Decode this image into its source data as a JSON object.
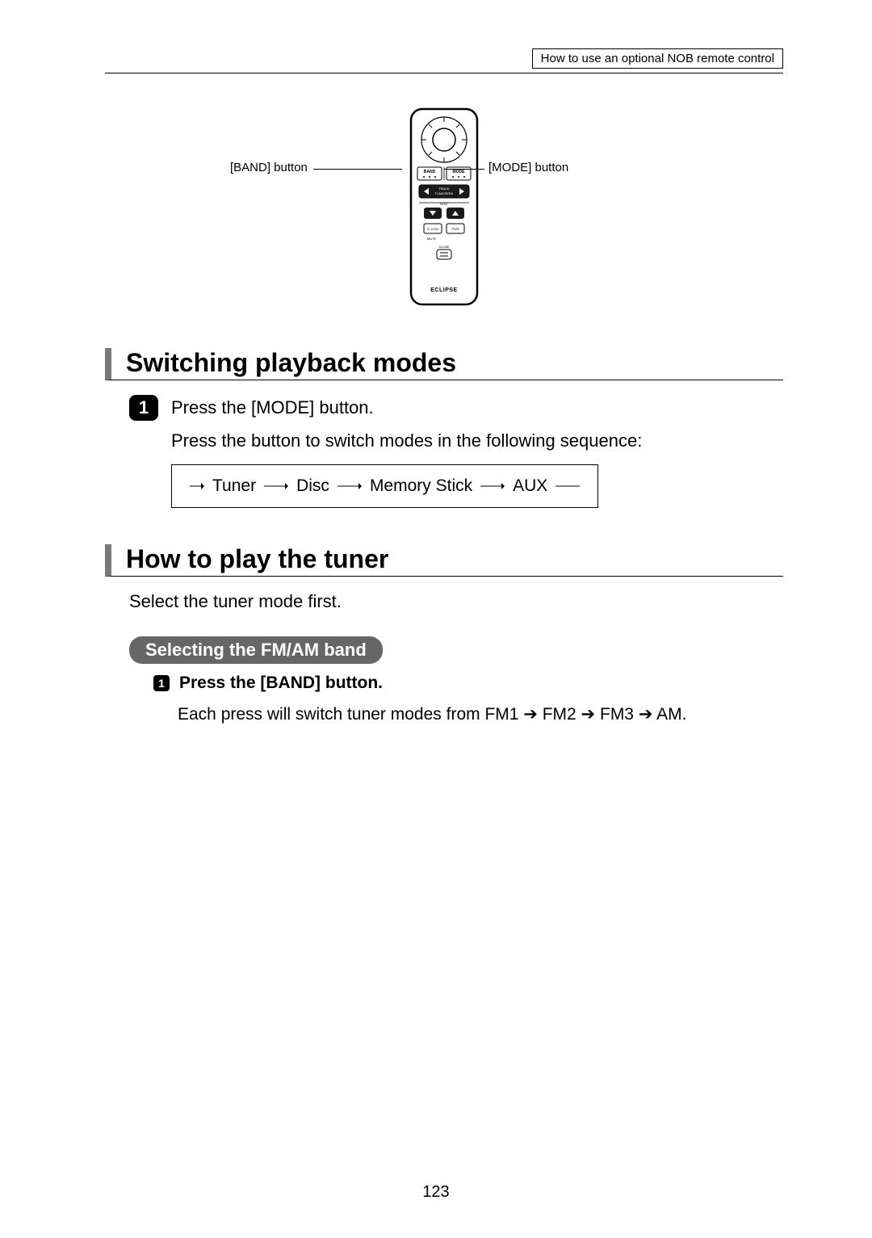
{
  "header": {
    "breadcrumb": "How to use an optional NOB remote control"
  },
  "remote": {
    "left_label": "[BAND] button",
    "right_label": "[MODE] button",
    "brand": "ECLIPSE",
    "btn_band": "BAND",
    "btn_mode": "MODE",
    "btn_track": "TRACK",
    "btn_tune": "TUNE/SEEK",
    "btn_disc": "DISC",
    "btn_ecom": "E-COM",
    "btn_pwr": "PWR",
    "btn_mute": "MUTE",
    "btn_illumi": "ILLUMI"
  },
  "section1": {
    "title": "Switching playback modes",
    "step1_num": "1",
    "step1_text": "Press the [MODE] button.",
    "body": "Press the button to switch modes in the following sequence:",
    "seq": {
      "a": "Tuner",
      "b": "Disc",
      "c": "Memory Stick",
      "d": "AUX"
    }
  },
  "section2": {
    "title": "How to play the tuner",
    "intro": "Select the tuner mode first.",
    "sub": "Selecting the FM/AM band",
    "step1_num": "1",
    "step1_text": "Press the [BAND] button.",
    "body": "Each press will switch tuner modes from FM1 ➔ FM2 ➔ FM3 ➔ AM."
  },
  "page_number": "123"
}
